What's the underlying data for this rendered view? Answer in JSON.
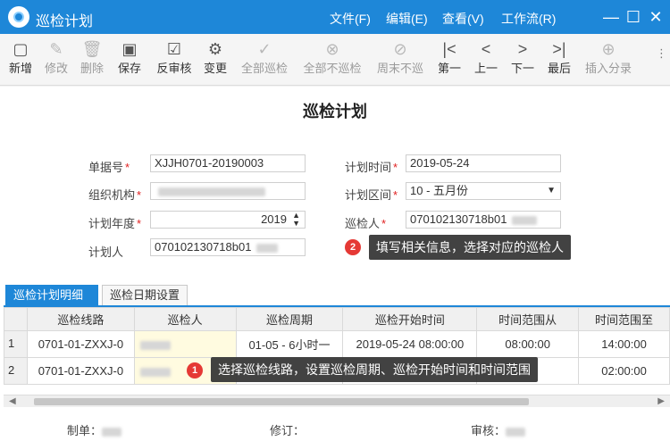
{
  "window": {
    "title": "巡检计划"
  },
  "menu": [
    "文件(F)",
    "编辑(E)",
    "查看(V)",
    "工作流(R)"
  ],
  "toolbar": [
    {
      "label": "新增",
      "icon": "add-icon",
      "enabled": true
    },
    {
      "label": "修改",
      "icon": "edit-icon",
      "enabled": false
    },
    {
      "label": "删除",
      "icon": "trash-icon",
      "enabled": false
    },
    {
      "label": "保存",
      "icon": "save-icon",
      "enabled": true
    },
    {
      "label": "反审核",
      "icon": "unaudit-icon",
      "enabled": true
    },
    {
      "label": "变更",
      "icon": "change-icon",
      "enabled": true
    },
    {
      "label": "全部巡检",
      "icon": "check-all-icon",
      "enabled": false
    },
    {
      "label": "全部不巡检",
      "icon": "uncheck-all-icon",
      "enabled": false
    },
    {
      "label": "周末不巡",
      "icon": "no-weekend-icon",
      "enabled": false
    },
    {
      "label": "第一",
      "icon": "first-icon",
      "enabled": true
    },
    {
      "label": "上一",
      "icon": "prev-icon",
      "enabled": true
    },
    {
      "label": "下一",
      "icon": "next-icon",
      "enabled": true
    },
    {
      "label": "最后",
      "icon": "last-icon",
      "enabled": true
    },
    {
      "label": "插入分录",
      "icon": "insert-row-icon",
      "enabled": false
    }
  ],
  "form": {
    "title": "巡检计划",
    "doc_no_label": "单据号",
    "doc_no": "XJJH0701-20190003",
    "plan_time_label": "计划时间",
    "plan_time": "2019-05-24",
    "org_label": "组织机构",
    "interval_label": "计划区间",
    "interval": "10 - 五月份",
    "year_label": "计划年度",
    "year": "2019",
    "inspector_label": "巡检人",
    "inspector": "070102130718b01",
    "planner_label": "计划人",
    "planner": "070102130718b01"
  },
  "callouts": {
    "one": {
      "num": "1",
      "text": "选择巡检线路，设置巡检周期、巡检开始时间和时间范围"
    },
    "two": {
      "num": "2",
      "text": "填写相关信息，选择对应的巡检人"
    }
  },
  "tabs": [
    "巡检计划明细",
    "巡检日期设置"
  ],
  "grid": {
    "columns": [
      "巡检线路",
      "巡检人",
      "巡检周期",
      "巡检开始时间",
      "时间范围从",
      "时间范围至"
    ],
    "rows": [
      {
        "n": "1",
        "route": "0701-01-ZXXJ-0",
        "period": "01-05 - 6小时一",
        "start": "2019-05-24 08:00:00",
        "from": "08:00:00",
        "to": "14:00:00"
      },
      {
        "n": "2",
        "route": "0701-01-ZXXJ-0",
        "period": "",
        "start": "",
        "from": "",
        "to": "02:00:00"
      }
    ]
  },
  "footer": {
    "maker_label": "制单：",
    "revise_label": "修订：",
    "audit_label": "审核："
  },
  "colors": {
    "accent": "#1e87d8",
    "required": "#e02020",
    "badge": "#e53935"
  }
}
